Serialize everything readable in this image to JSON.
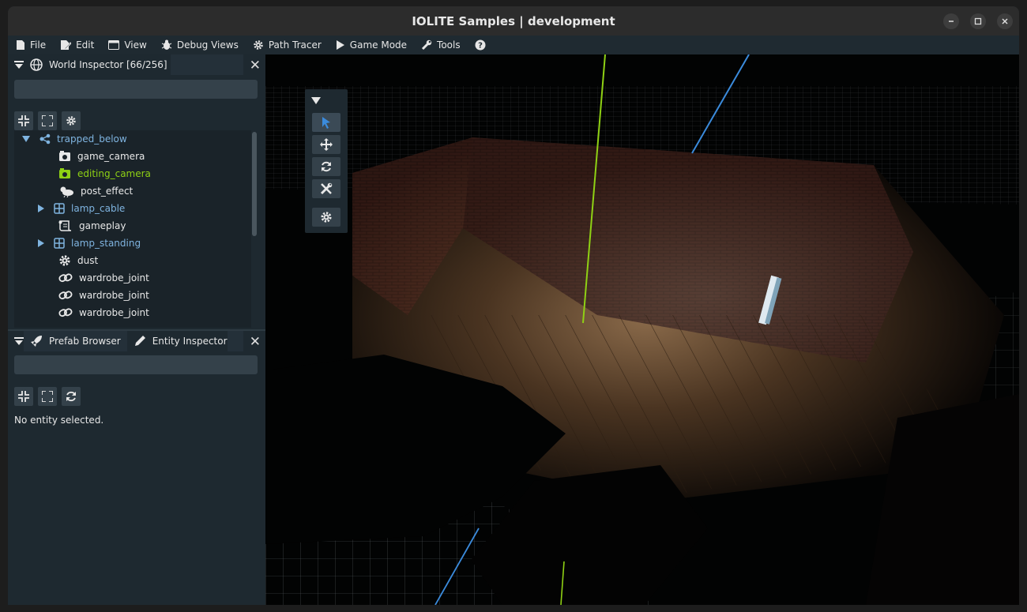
{
  "window": {
    "title": "IOLITE Samples | development"
  },
  "menu": [
    {
      "label": "File",
      "icon": "file-icon"
    },
    {
      "label": "Edit",
      "icon": "edit-icon"
    },
    {
      "label": "View",
      "icon": "window-icon"
    },
    {
      "label": "Debug Views",
      "icon": "bug-icon"
    },
    {
      "label": "Path Tracer",
      "icon": "gear-icon"
    },
    {
      "label": "Game Mode",
      "icon": "play-icon"
    },
    {
      "label": "Tools",
      "icon": "wrench-icon"
    }
  ],
  "world_inspector": {
    "title": "World Inspector [66/256]",
    "search_placeholder": "",
    "tree": [
      {
        "label": "trapped_below",
        "icon": "node-tree-icon",
        "color": "#7fb4e0",
        "expanded": true
      },
      {
        "label": "game_camera",
        "icon": "camera-icon",
        "color": "#e8e8e8"
      },
      {
        "label": "editing_camera",
        "icon": "camera-icon",
        "color": "#8fd114"
      },
      {
        "label": "post_effect",
        "icon": "weather-icon",
        "color": "#e8e8e8"
      },
      {
        "label": "lamp_cable",
        "icon": "grid-icon",
        "color": "#7fb4e0",
        "expandable": true
      },
      {
        "label": "gameplay",
        "icon": "script-icon",
        "color": "#e8e8e8"
      },
      {
        "label": "lamp_standing",
        "icon": "grid-icon",
        "color": "#7fb4e0",
        "expandable": true
      },
      {
        "label": "dust",
        "icon": "gear-icon",
        "color": "#e8e8e8"
      },
      {
        "label": "wardrobe_joint",
        "icon": "link-icon",
        "color": "#e8e8e8"
      },
      {
        "label": "wardrobe_joint",
        "icon": "link-icon",
        "color": "#e8e8e8"
      },
      {
        "label": "wardrobe_joint",
        "icon": "link-icon",
        "color": "#e8e8e8"
      }
    ]
  },
  "bottom_panel": {
    "tabs": [
      {
        "label": "Prefab Browser"
      },
      {
        "label": "Entity Inspector"
      }
    ],
    "search_placeholder": "",
    "message": "No entity selected."
  },
  "colors": {
    "accent": "#3b8bdc",
    "selected_text": "#8fd114",
    "folder_text": "#7fb4e0"
  }
}
